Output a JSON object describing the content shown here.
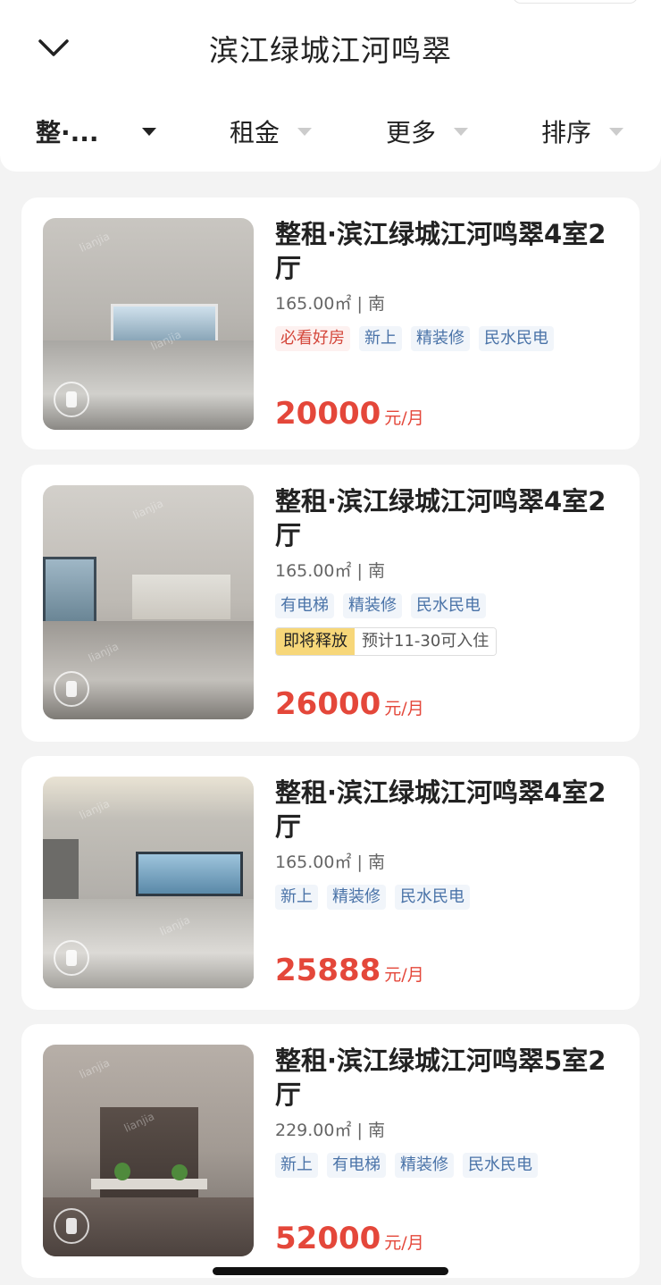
{
  "header": {
    "title": "滨江绿城江河鸣翠",
    "filters": [
      {
        "label": "整·...",
        "active": true
      },
      {
        "label": "租金",
        "active": false
      },
      {
        "label": "更多",
        "active": false
      },
      {
        "label": "排序",
        "active": false
      }
    ]
  },
  "listings": [
    {
      "title": "整租·滨江绿城江河鸣翠4室2厅",
      "meta": "165.00㎡ | 南",
      "tags": [
        {
          "text": "必看好房",
          "style": "red"
        },
        {
          "text": "新上",
          "style": "blue"
        },
        {
          "text": "精装修",
          "style": "blue"
        },
        {
          "text": "民水民电",
          "style": "blue"
        }
      ],
      "price": "20000",
      "unit": "元/月"
    },
    {
      "title": "整租·滨江绿城江河鸣翠4室2厅",
      "meta": "165.00㎡ | 南",
      "tags": [
        {
          "text": "有电梯",
          "style": "blue"
        },
        {
          "text": "精装修",
          "style": "blue"
        },
        {
          "text": "民水民电",
          "style": "blue"
        }
      ],
      "release_highlight": "即将释放",
      "release_text": "预计11-30可入住",
      "price": "26000",
      "unit": "元/月"
    },
    {
      "title": "整租·滨江绿城江河鸣翠4室2厅",
      "meta": "165.00㎡ | 南",
      "tags": [
        {
          "text": "新上",
          "style": "blue"
        },
        {
          "text": "精装修",
          "style": "blue"
        },
        {
          "text": "民水民电",
          "style": "blue"
        }
      ],
      "price": "25888",
      "unit": "元/月"
    },
    {
      "title": "整租·滨江绿城江河鸣翠5室2厅",
      "meta": "229.00㎡ | 南",
      "tags": [
        {
          "text": "新上",
          "style": "blue"
        },
        {
          "text": "有电梯",
          "style": "blue"
        },
        {
          "text": "精装修",
          "style": "blue"
        },
        {
          "text": "民水民电",
          "style": "blue"
        }
      ],
      "price": "52000",
      "unit": "元/月"
    }
  ],
  "icons": {
    "back": "chevron-down-icon",
    "vr": "vr-view-icon"
  },
  "colors": {
    "price": "#e4473a",
    "tag_blue": "#4a73a8",
    "tag_red": "#d4473b",
    "release_highlight": "#f7d779"
  }
}
